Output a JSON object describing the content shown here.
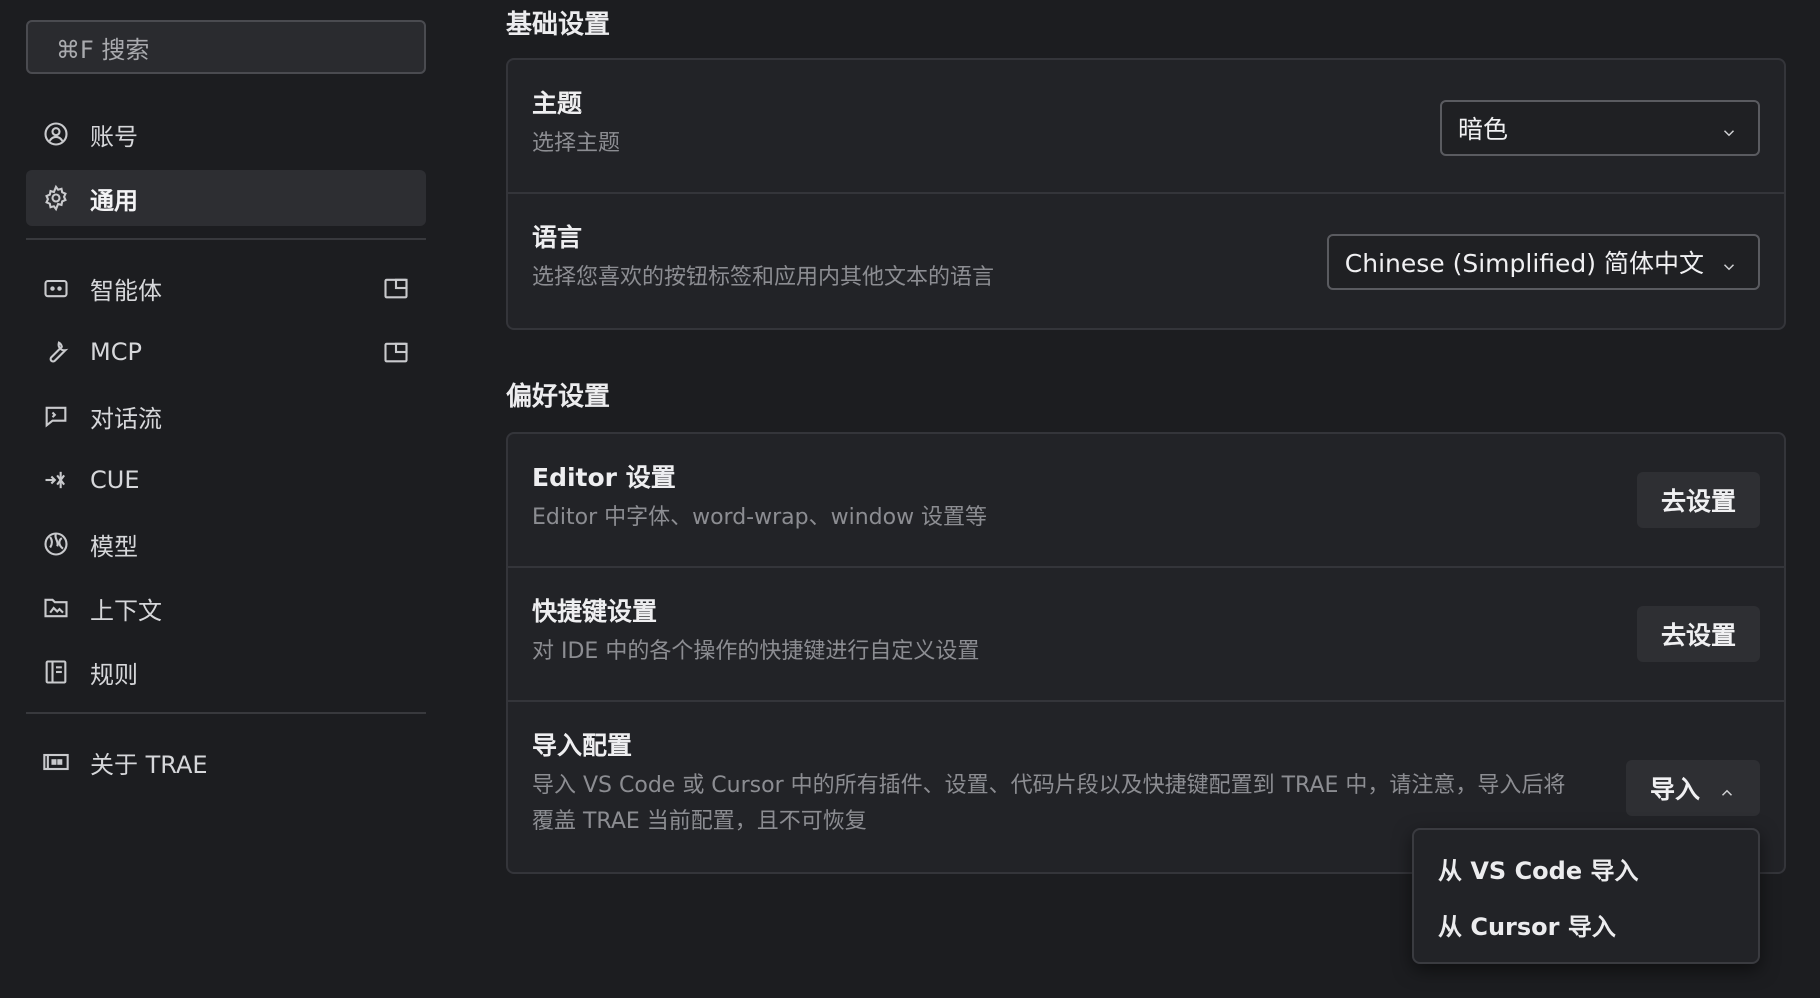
{
  "sidebar": {
    "search_placeholder": "⌘F 搜索",
    "items_top": [
      {
        "label": "账号",
        "icon": "user-circle-icon"
      },
      {
        "label": "通用",
        "icon": "gear-icon",
        "active": true
      }
    ],
    "items_mid": [
      {
        "label": "智能体",
        "icon": "agent-icon",
        "external": true
      },
      {
        "label": "MCP",
        "icon": "wrench-icon",
        "external": true
      },
      {
        "label": "对话流",
        "icon": "chat-icon"
      },
      {
        "label": "CUE",
        "icon": "cue-icon"
      },
      {
        "label": "模型",
        "icon": "model-icon"
      },
      {
        "label": "上下文",
        "icon": "folder-icon"
      },
      {
        "label": "规则",
        "icon": "rules-icon"
      }
    ],
    "items_bottom": [
      {
        "label": "关于 TRAE",
        "icon": "trae-logo-icon"
      }
    ]
  },
  "main": {
    "basic_section": {
      "title": "基础设置",
      "theme": {
        "title": "主题",
        "desc": "选择主题",
        "value": "暗色"
      },
      "language": {
        "title": "语言",
        "desc": "选择您喜欢的按钮标签和应用内其他文本的语言",
        "value": "Chinese (Simplified) 简体中文"
      }
    },
    "pref_section": {
      "title": "偏好设置",
      "editor": {
        "title": "Editor 设置",
        "desc": "Editor 中字体、word-wrap、window 设置等",
        "button": "去设置"
      },
      "shortcuts": {
        "title": "快捷键设置",
        "desc": "对 IDE 中的各个操作的快捷键进行自定义设置",
        "button": "去设置"
      },
      "import": {
        "title": "导入配置",
        "desc": "导入 VS Code 或 Cursor 中的所有插件、设置、代码片段以及快捷键配置到 TRAE 中，请注意，导入后将覆盖 TRAE 当前配置，且不可恢复",
        "button": "导入",
        "menu": [
          "从 VS Code 导入",
          "从 Cursor 导入"
        ]
      }
    }
  }
}
